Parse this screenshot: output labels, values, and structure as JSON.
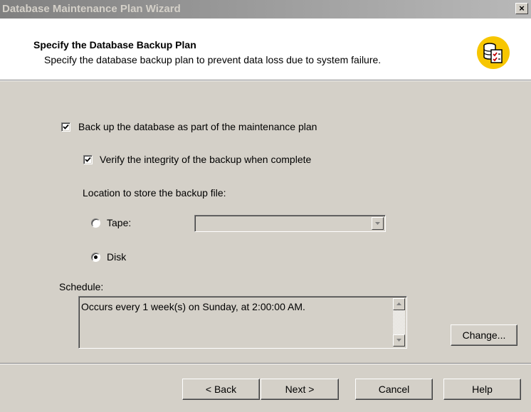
{
  "window": {
    "title": "Database Maintenance Plan Wizard",
    "close_label": "×"
  },
  "header": {
    "title": "Specify the Database Backup Plan",
    "subtitle": "Specify the database backup plan to prevent data loss due to system failure.",
    "icon": "database-checklist-icon"
  },
  "options": {
    "backup_label": "Back up the database as part of the maintenance plan",
    "backup_checked": true,
    "verify_label": "Verify the integrity of the backup when complete",
    "verify_checked": true,
    "location_label": "Location to store the backup file:",
    "tape_label": "Tape:",
    "disk_label": "Disk",
    "selected_location": "Disk",
    "tape_value": ""
  },
  "schedule": {
    "label": "Schedule:",
    "text": "Occurs every 1 week(s) on Sunday, at 2:00:00 AM.",
    "change_label": "Change..."
  },
  "footer": {
    "back_label": "< Back",
    "next_label": "Next >",
    "cancel_label": "Cancel",
    "help_label": "Help"
  },
  "colors": {
    "face": "#d4d0c8",
    "titlebar_start": "#808080",
    "titlebar_end": "#b9b9b9",
    "icon_yellow": "#f7c600"
  }
}
